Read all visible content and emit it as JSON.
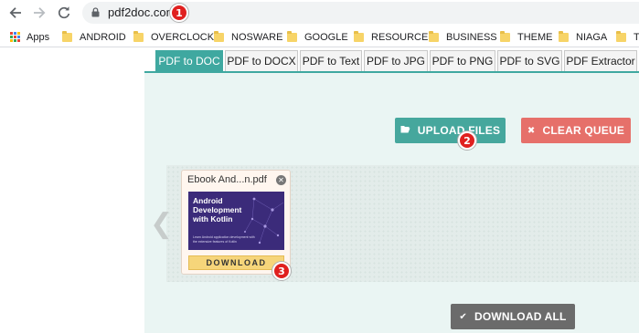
{
  "browser": {
    "url": "pdf2doc.com",
    "back_icon": "arrow-left-icon",
    "forward_icon": "arrow-right-icon",
    "reload_icon": "reload-icon",
    "lock_icon": "lock-icon"
  },
  "bookmarks": {
    "apps_label": "Apps",
    "items": [
      "ANDROID",
      "OVERCLOCK",
      "NOSWARE",
      "GOOGLE",
      "RESOURCE",
      "BUSINESS",
      "THEME",
      "NIAGA",
      "T"
    ]
  },
  "tabs": [
    {
      "label": "PDF to DOC",
      "active": true
    },
    {
      "label": "PDF to DOCX",
      "active": false
    },
    {
      "label": "PDF to Text",
      "active": false
    },
    {
      "label": "PDF to JPG",
      "active": false
    },
    {
      "label": "PDF to PNG",
      "active": false
    },
    {
      "label": "PDF to SVG",
      "active": false
    },
    {
      "label": "PDF Extractor",
      "active": false
    }
  ],
  "actions": {
    "upload_label": "UPLOAD FILES",
    "clear_label": "CLEAR QUEUE",
    "download_all_label": "DOWNLOAD ALL"
  },
  "queue": {
    "file_name": "Ebook And...n.pdf",
    "thumb_title": "Android Development with Kotlin",
    "thumb_subtitle": "Learn Android application development with the extensive features of Kotlin",
    "download_label": "DOWNLOAD"
  },
  "annotations": [
    "1",
    "2",
    "3"
  ],
  "colors": {
    "accent": "#3fa8a0",
    "upload": "#46a79d",
    "clear": "#e6706a",
    "download_all": "#6b6b6b",
    "download": "#f6d57a",
    "badge": "#e0201f"
  }
}
